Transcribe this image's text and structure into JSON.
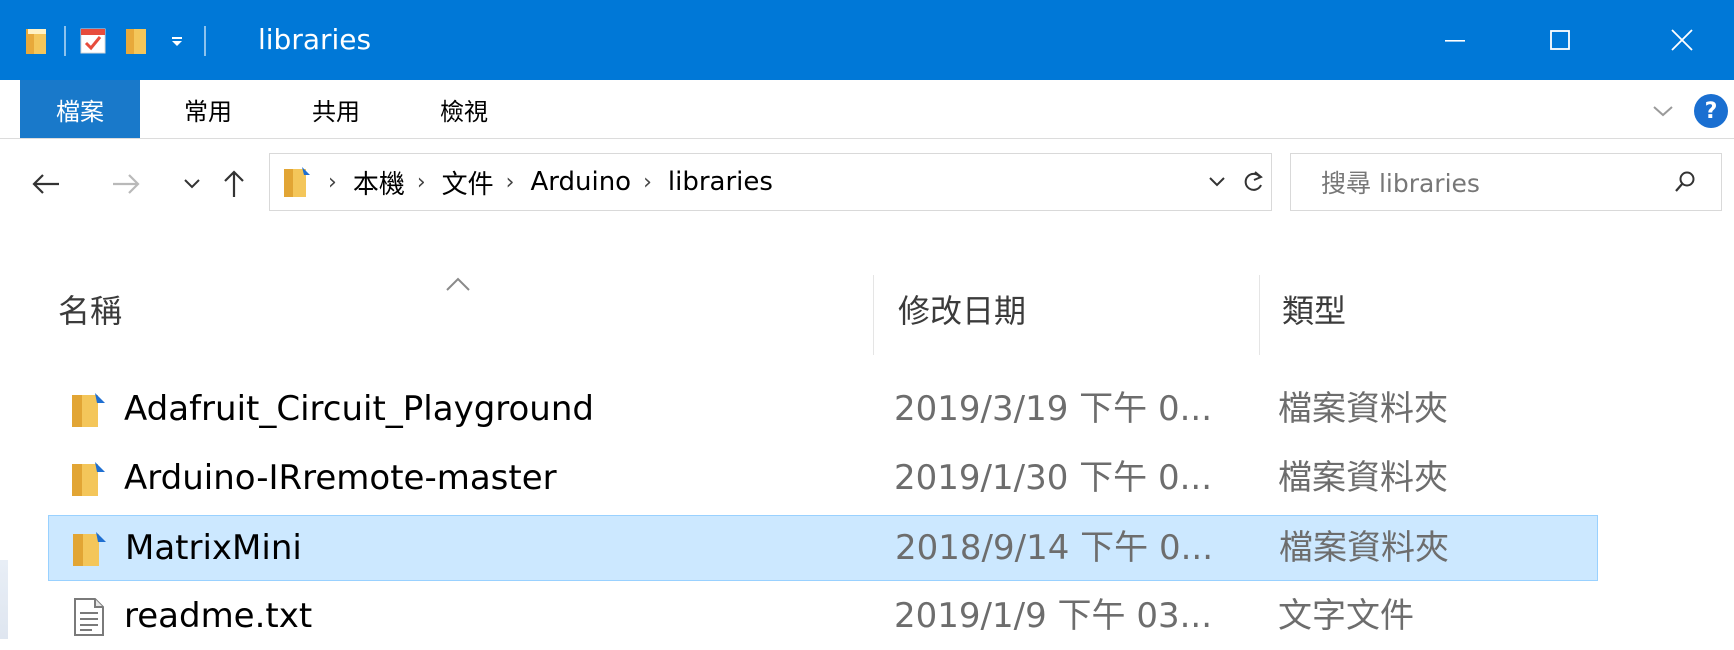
{
  "window": {
    "title": "libraries",
    "controls": {
      "minimize": "minimize",
      "maximize": "maximize",
      "close": "close"
    },
    "accent": "#0078d7"
  },
  "ribbon": {
    "tabs": [
      {
        "label": "檔案",
        "active": true
      },
      {
        "label": "常用"
      },
      {
        "label": "共用"
      },
      {
        "label": "檢視"
      }
    ],
    "help_label": "?"
  },
  "navigation": {
    "breadcrumb": [
      "本機",
      "文件",
      "Arduino",
      "libraries"
    ],
    "search_placeholder": "搜尋 libraries"
  },
  "columns": {
    "name": "名稱",
    "date": "修改日期",
    "type": "類型"
  },
  "files": [
    {
      "name": "Adafruit_Circuit_Playground",
      "date": "2019/3/19 下午 0...",
      "type": "檔案資料夾",
      "icon": "folder-icon",
      "selected": false
    },
    {
      "name": "Arduino-IRremote-master",
      "date": "2019/1/30 下午 0...",
      "type": "檔案資料夾",
      "icon": "folder-icon",
      "selected": false
    },
    {
      "name": "MatrixMini",
      "date": "2018/9/14 下午 0...",
      "type": "檔案資料夾",
      "icon": "folder-icon",
      "selected": true
    },
    {
      "name": "readme.txt",
      "date": "2019/1/9 下午 03...",
      "type": "文字文件",
      "icon": "text-file-icon",
      "selected": false
    }
  ],
  "colors": {
    "selection_bg": "#cce8ff",
    "selection_border": "#99d1ff",
    "file_tab": "#1979ca"
  }
}
